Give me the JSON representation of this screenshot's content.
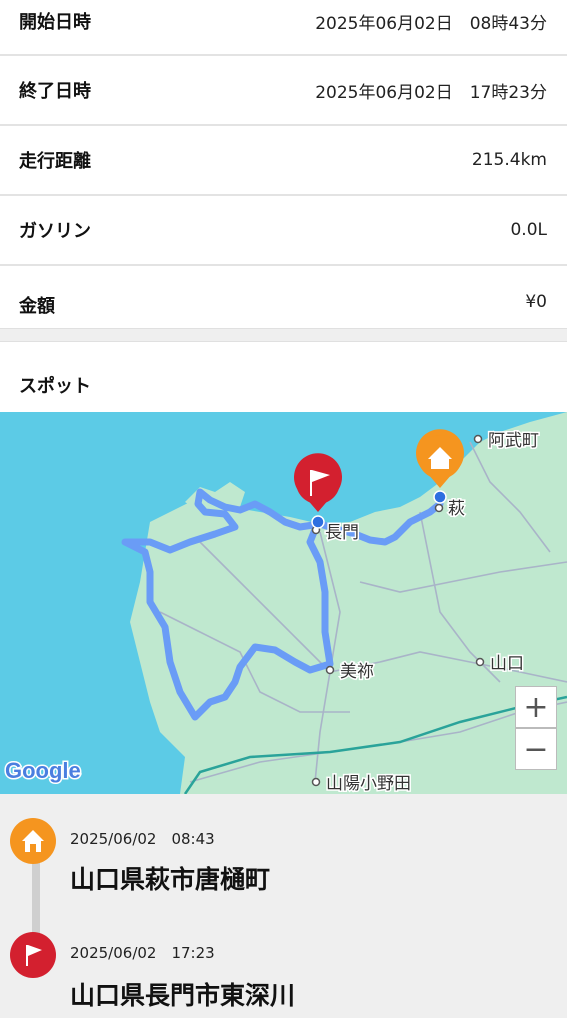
{
  "summary": {
    "start": {
      "label": "開始日時",
      "value": "2025年06月02日　08時43分"
    },
    "end": {
      "label": "終了日時",
      "value": "2025年06月02日　17時23分"
    },
    "distance": {
      "label": "走行距離",
      "value": "215.4km"
    },
    "gasoline": {
      "label": "ガソリン",
      "value": "0.0L"
    },
    "amount": {
      "label": "金額",
      "value": "¥0"
    }
  },
  "spots": {
    "title": "スポット"
  },
  "map": {
    "places": {
      "abu": "阿武町",
      "hagi": "萩",
      "nagato": "長門",
      "yamaguchi": "山口",
      "mine": "美祢",
      "sanyo": "山陽小野田"
    },
    "google_label": "Google",
    "zoom_in": "+",
    "zoom_out": "−",
    "colors": {
      "sea": "#5ccbe6",
      "land": "#bfe8cf",
      "route": "#6a9cf6",
      "home_pin": "#f5951f",
      "flag_pin": "#d3202f"
    }
  },
  "timeline": [
    {
      "icon": "home-icon",
      "time": "2025/06/02　08:43",
      "address": "山口県萩市唐樋町"
    },
    {
      "icon": "flag-icon",
      "time": "2025/06/02　17:23",
      "address": "山口県長門市東深川"
    }
  ]
}
